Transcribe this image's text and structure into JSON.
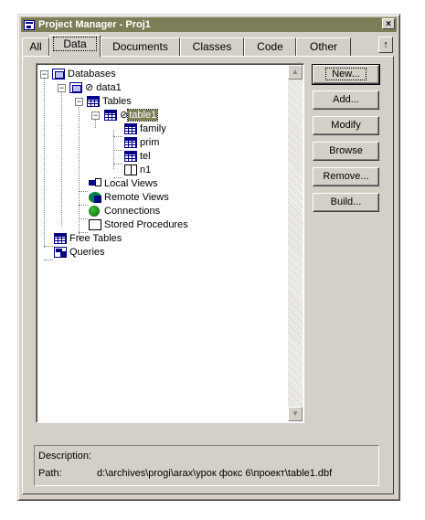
{
  "window": {
    "title": "Project Manager - Proj1",
    "close_label": "×"
  },
  "tabs": [
    "All",
    "Data",
    "Documents",
    "Classes",
    "Code",
    "Other"
  ],
  "active_tab": "Data",
  "tab_arrow": "↑",
  "tree": {
    "databases": "Databases",
    "data1": "⊘ data1",
    "tables": "Tables",
    "table1_prefix": "⊘",
    "table1": "table1",
    "family": "family",
    "prim": "prim",
    "tel": "tel",
    "n1": "n1",
    "local_views": "Local Views",
    "remote_views": "Remote Views",
    "connections": "Connections",
    "stored_procedures": "Stored Procedures",
    "free_tables": "Free Tables",
    "queries": "Queries"
  },
  "buttons": {
    "new": "New...",
    "add": "Add...",
    "modify": "Modify",
    "browse": "Browse",
    "remove": "Remove...",
    "build": "Build..."
  },
  "description": {
    "description_label": "Description:",
    "path_label": "Path:",
    "path_value": "d:\\archives\\progi\\arax\\урок фокс 6\\проект\\table1.dbf"
  },
  "colors": {
    "titlebar": "#7d7d58",
    "face": "#d4d0c8",
    "selection": "#7d7d58"
  }
}
